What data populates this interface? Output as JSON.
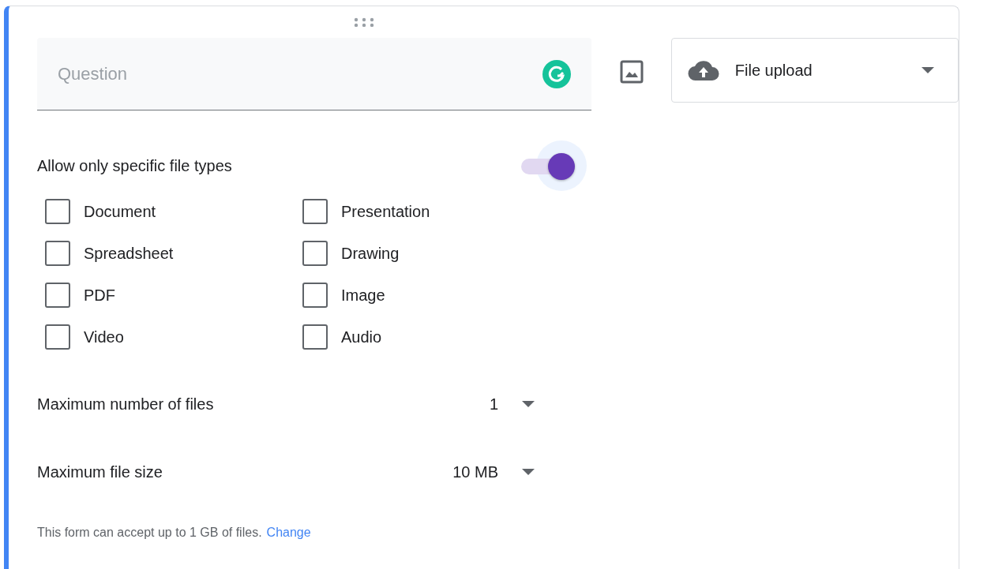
{
  "question": {
    "placeholder": "Question"
  },
  "type_dropdown": {
    "value": "File upload"
  },
  "file_types": {
    "label": "Allow only specific file types",
    "on": true,
    "options": [
      {
        "label": "Document",
        "checked": false
      },
      {
        "label": "Presentation",
        "checked": false
      },
      {
        "label": "Spreadsheet",
        "checked": false
      },
      {
        "label": "Drawing",
        "checked": false
      },
      {
        "label": "PDF",
        "checked": false
      },
      {
        "label": "Image",
        "checked": false
      },
      {
        "label": "Video",
        "checked": false
      },
      {
        "label": "Audio",
        "checked": false
      }
    ]
  },
  "settings": [
    {
      "label": "Maximum number of files",
      "value": "1"
    },
    {
      "label": "Maximum file size",
      "value": "10 MB"
    }
  ],
  "note": {
    "text": "This form can accept up to 1 GB of files.",
    "link": "Change"
  }
}
